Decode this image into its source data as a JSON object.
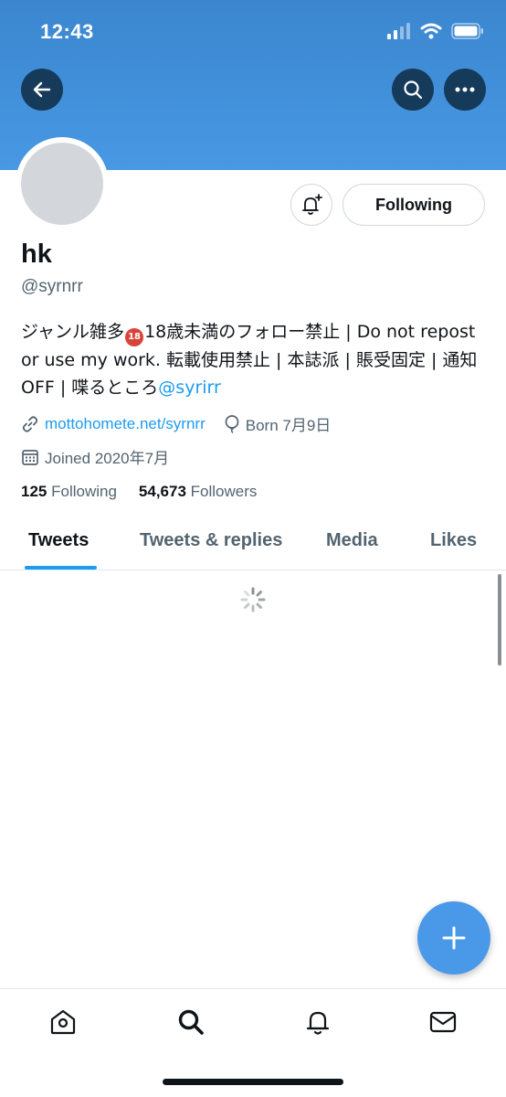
{
  "status_bar": {
    "time": "12:43"
  },
  "header": {
    "back_icon": "arrow-left-icon",
    "search_icon": "search-icon",
    "more_icon": "ellipsis-icon",
    "banner_color": "#4898e3"
  },
  "profile": {
    "display_name": "hk",
    "handle": "@syrnrr",
    "bio_part1": "ジャンル雑多",
    "bio_badge": "18",
    "bio_part2": "18歳未満のフォロー禁止 | Do not repost or use my work. 転載使用禁止 | 本誌派 | 賬受固定 | 通知OFF | 喋るところ",
    "bio_mention": "@syrirr",
    "website": "mottohomete.net/syrnrr",
    "birthday": "Born 7月9日",
    "joined": "Joined 2020年7月",
    "following_count": "125",
    "following_label": "Following",
    "followers_count": "54,673",
    "followers_label": "Followers",
    "following_button": "Following"
  },
  "tabs": [
    {
      "label": "Tweets",
      "active": true
    },
    {
      "label": "Tweets & replies",
      "active": false
    },
    {
      "label": "Media",
      "active": false
    },
    {
      "label": "Likes",
      "active": false
    }
  ],
  "colors": {
    "accent": "#1d9bf0",
    "fab": "#4a99e9"
  },
  "bottom_nav": [
    "home-icon",
    "search-icon",
    "bell-icon",
    "mail-icon"
  ]
}
